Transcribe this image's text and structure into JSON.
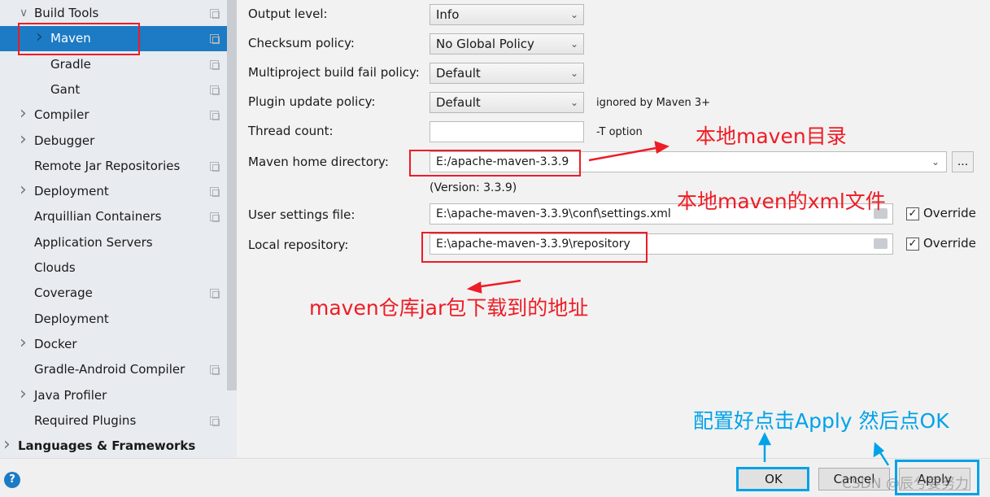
{
  "sidebar": {
    "items": [
      {
        "label": "Build Tools",
        "indent": 0,
        "arrow": "down",
        "copy": true
      },
      {
        "label": "Maven",
        "indent": 1,
        "arrow": "right",
        "copy": true,
        "selected": true
      },
      {
        "label": "Gradle",
        "indent": 1,
        "copy": true
      },
      {
        "label": "Gant",
        "indent": 1,
        "copy": true
      },
      {
        "label": "Compiler",
        "indent": 0,
        "arrow": "right",
        "copy": true
      },
      {
        "label": "Debugger",
        "indent": 0,
        "arrow": "right"
      },
      {
        "label": "Remote Jar Repositories",
        "indent": 0,
        "copy": true
      },
      {
        "label": "Deployment",
        "indent": 0,
        "arrow": "right",
        "copy": true
      },
      {
        "label": "Arquillian Containers",
        "indent": 0,
        "copy": true
      },
      {
        "label": "Application Servers",
        "indent": 0
      },
      {
        "label": "Clouds",
        "indent": 0
      },
      {
        "label": "Coverage",
        "indent": 0,
        "copy": true
      },
      {
        "label": "Deployment",
        "indent": 0
      },
      {
        "label": "Docker",
        "indent": 0,
        "arrow": "right"
      },
      {
        "label": "Gradle-Android Compiler",
        "indent": 0,
        "copy": true
      },
      {
        "label": "Java Profiler",
        "indent": 0,
        "arrow": "right"
      },
      {
        "label": "Required Plugins",
        "indent": 0,
        "copy": true
      },
      {
        "label": "Languages & Frameworks",
        "indent": -1,
        "arrow": "right",
        "bold": true
      }
    ]
  },
  "form": {
    "output_level": {
      "label": "Output level:",
      "value": "Info"
    },
    "checksum": {
      "label": "Checksum policy:",
      "value": "No Global Policy"
    },
    "multiproject": {
      "label": "Multiproject build fail policy:",
      "value": "Default"
    },
    "plugin_update": {
      "label": "Plugin update policy:",
      "value": "Default",
      "hint": "ignored by Maven 3+"
    },
    "thread_count": {
      "label": "Thread count:",
      "value": "",
      "hint": "-T option"
    },
    "maven_home": {
      "label": "Maven home directory:",
      "value": "E:/apache-maven-3.3.9",
      "browse": "...",
      "version": "(Version: 3.3.9)"
    },
    "user_settings": {
      "label": "User settings file:",
      "value": "E:\\apache-maven-3.3.9\\conf\\settings.xml",
      "override": "Override",
      "checked": true
    },
    "local_repo": {
      "label": "Local repository:",
      "value": "E:\\apache-maven-3.3.9\\repository",
      "override": "Override",
      "checked": true
    }
  },
  "buttons": {
    "ok": "OK",
    "cancel": "Cancel",
    "apply": "Apply",
    "help": "?"
  },
  "annotations": {
    "maven_home": "本地maven目录",
    "settings": "本地maven的xml文件",
    "repo": "maven仓库jar包下载到的地址",
    "apply": "配置好点击Apply 然后点OK"
  },
  "watermark": "CSDN @辰兮要努力",
  "colors": {
    "selection": "#1c7bc4",
    "annotation_red": "#ee1c25",
    "annotation_blue": "#00a2e8"
  }
}
